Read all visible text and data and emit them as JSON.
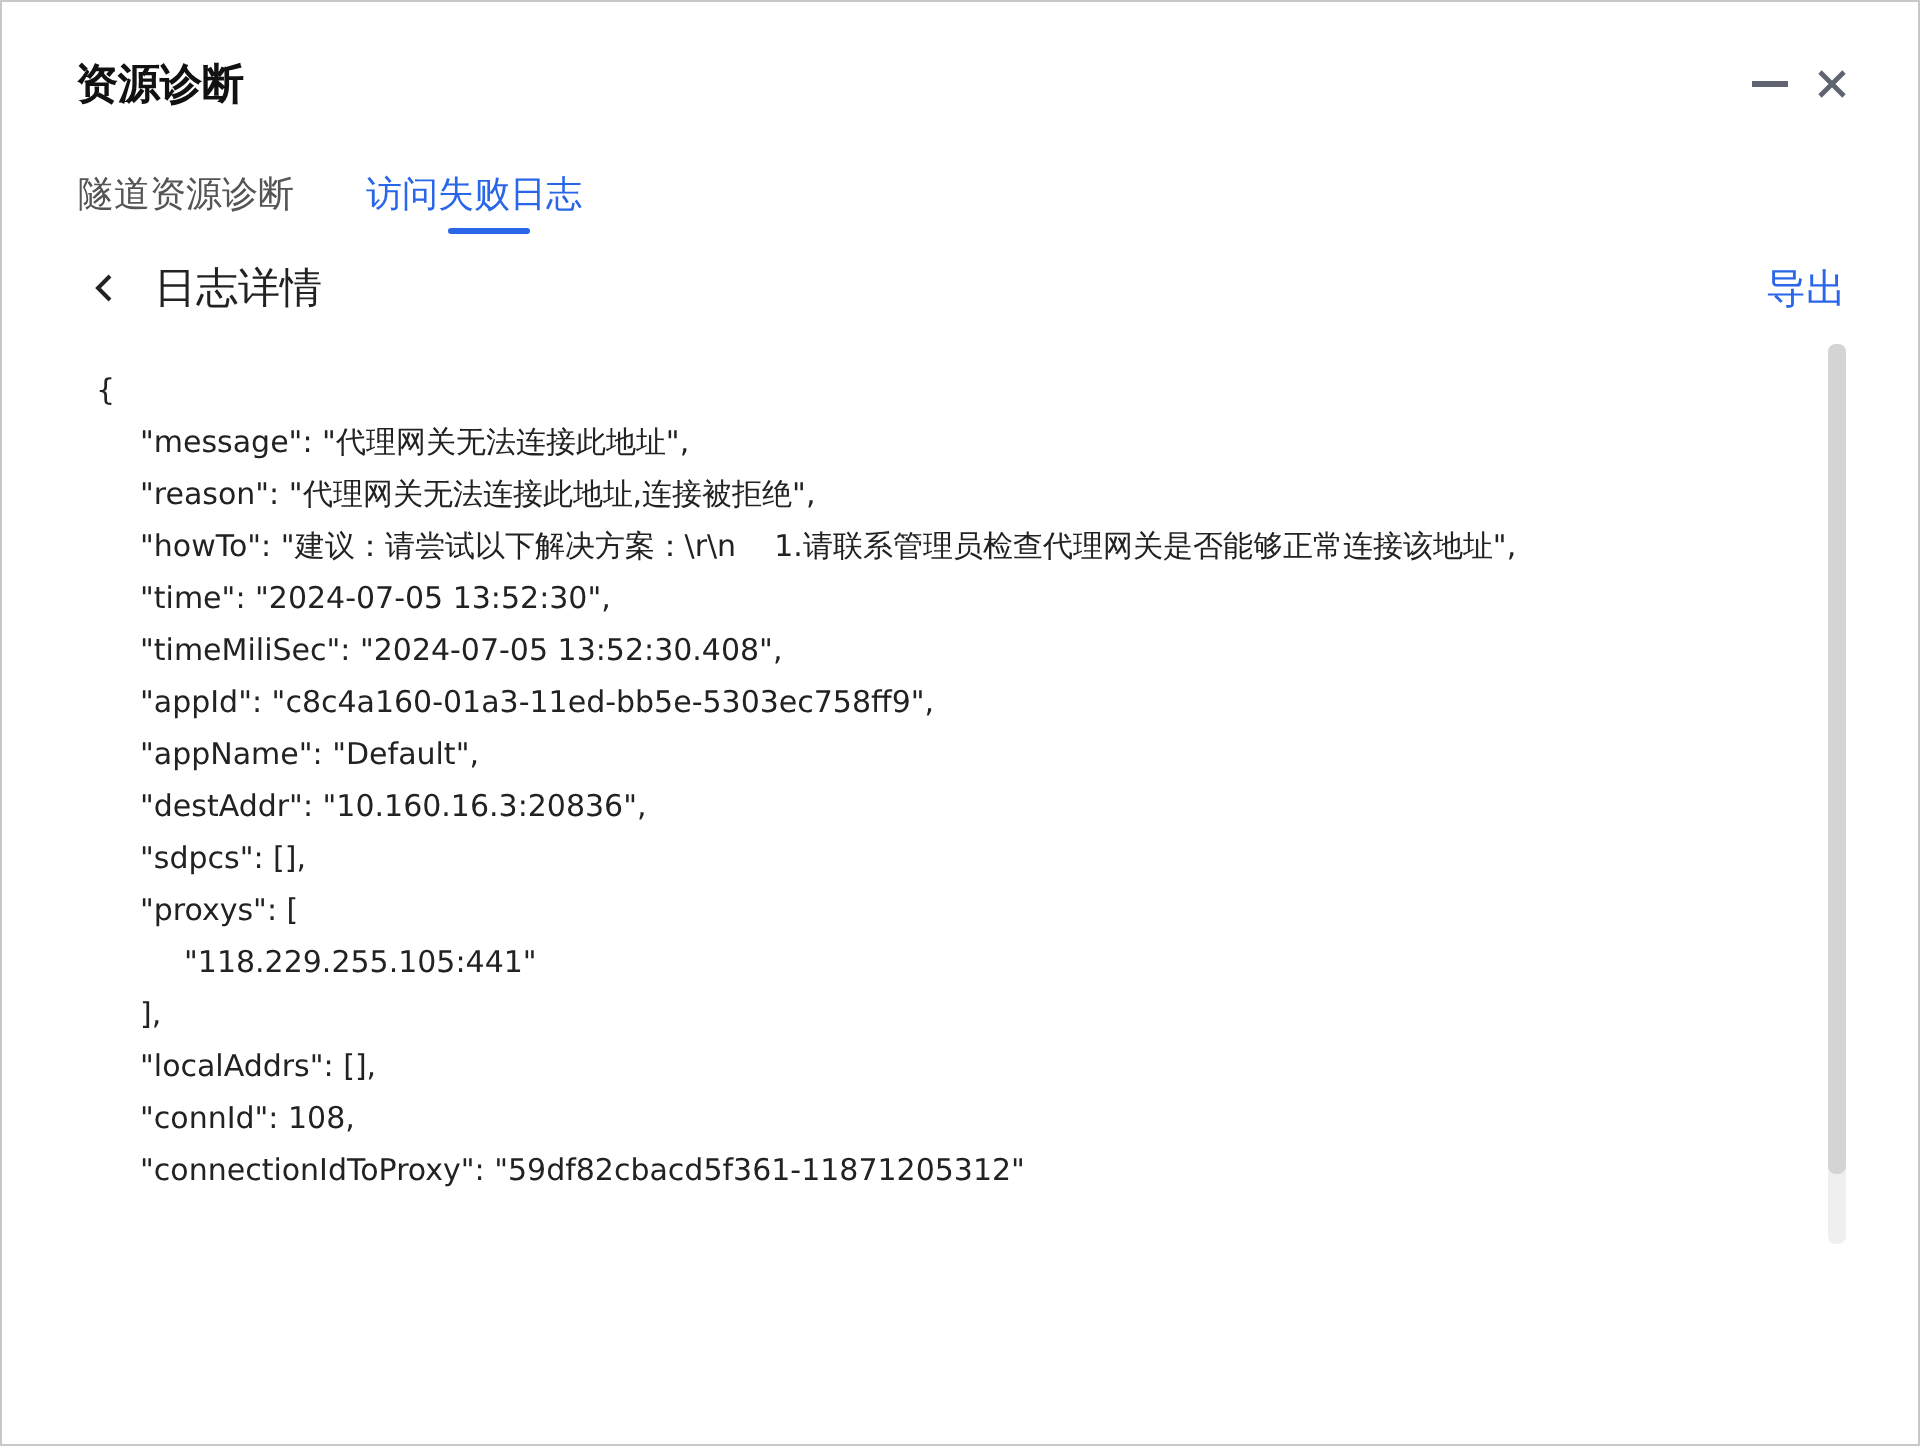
{
  "window": {
    "title": "资源诊断"
  },
  "tabs": [
    {
      "label": "隧道资源诊断",
      "selected": false
    },
    {
      "label": "访问失败日志",
      "selected": true
    }
  ],
  "detail": {
    "title": "日志详情",
    "export": "导出",
    "code": [
      {
        "text": "{",
        "children": [
          {
            "text": "\"message\": \"代理网关无法连接此地址\","
          },
          {
            "text": "\"reason\": \"代理网关无法连接此地址,连接被拒绝\","
          },
          {
            "text": "\"howTo\": \"建议：请尝试以下解决方案：\\r\\n    1.请联系管理员检查代理网关是否能够正常连接该地址\","
          },
          {
            "text": "\"time\": \"2024-07-05 13:52:30\","
          },
          {
            "text": "\"timeMiliSec\": \"2024-07-05 13:52:30.408\","
          },
          {
            "text": "\"appId\": \"c8c4a160-01a3-11ed-bb5e-5303ec758ff9\","
          },
          {
            "text": "\"appName\": \"Default\","
          },
          {
            "text": "\"destAddr\": \"10.160.16.3:20836\","
          },
          {
            "text": "\"sdpcs\": [],"
          },
          {
            "text": "\"proxys\": [",
            "children": [
              {
                "text": "\"118.229.255.105:441\""
              }
            ]
          },
          {
            "text": "],"
          },
          {
            "text": "\"localAddrs\": [],"
          },
          {
            "text": "\"connId\": 108,"
          },
          {
            "text": "\"connectionIdToProxy\": \"59df82cbacd5f361-11871205312\""
          }
        ]
      }
    ]
  }
}
